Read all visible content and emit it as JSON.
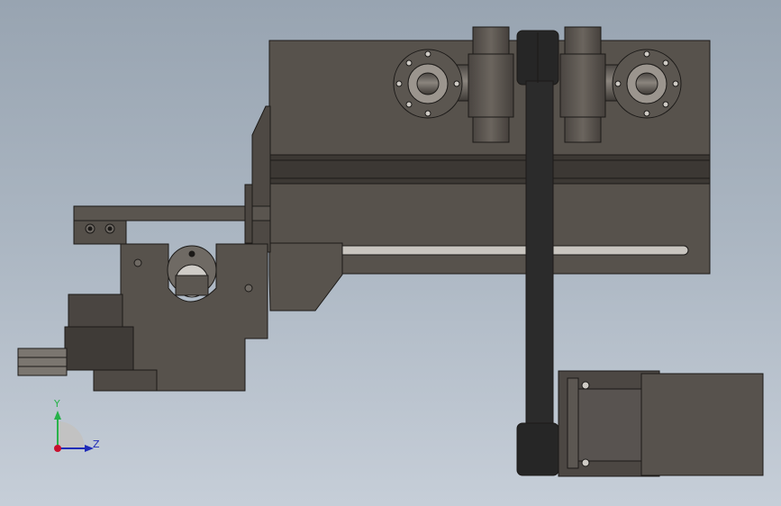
{
  "viewport": {
    "background_top": "#98a4b1",
    "background_bottom": "#c6ced8",
    "part_color": "#55504b",
    "part_edge": "#1c1a18",
    "belt_color": "#262626"
  },
  "triad": {
    "y_label": "Y",
    "z_label": "Z",
    "y_color": "#27b24a",
    "z_color": "#1f2bb8",
    "origin_color": "#c8102e"
  },
  "icons": {
    "triad": "view-orientation-triad-icon",
    "bearing": "flange-bearing-icon",
    "motor": "motor-icon",
    "belt": "drive-belt-icon"
  }
}
